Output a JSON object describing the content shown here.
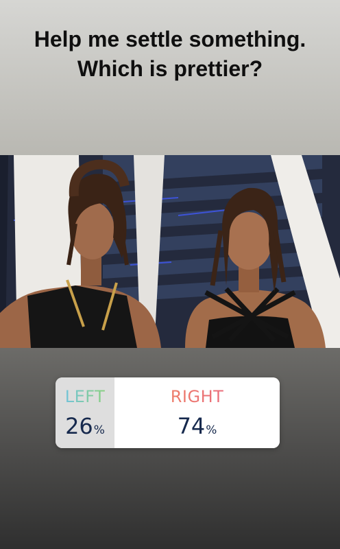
{
  "question": "Help me settle something. Which is prettier?",
  "poll": {
    "left": {
      "label": "LEFT",
      "percent": "26",
      "percent_sign": "%",
      "share": 0.26
    },
    "right": {
      "label": "RIGHT",
      "percent": "74",
      "percent_sign": "%",
      "share": 0.74
    }
  },
  "colors": {
    "left_label_gradient": [
      "#6cc0ee",
      "#8fd36c"
    ],
    "right_label_gradient": [
      "#f08d57",
      "#e75d8e"
    ],
    "percent_text": "#16294d"
  }
}
